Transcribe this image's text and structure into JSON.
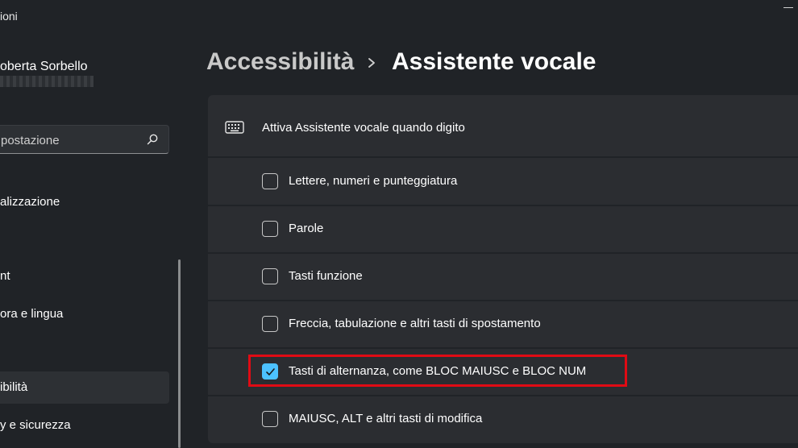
{
  "app": {
    "title": "ioni"
  },
  "user": {
    "name": "oberta Sorbello"
  },
  "search": {
    "text": "postazione"
  },
  "nav": {
    "items": [
      {
        "label": "alizzazione"
      },
      {
        "label": "nt"
      },
      {
        "label": "ora e lingua"
      },
      {
        "label": "ibilità"
      },
      {
        "label": "y e sicurezza"
      }
    ]
  },
  "breadcrumb": {
    "parent": "Accessibilità",
    "current": "Assistente vocale"
  },
  "section": {
    "header_label": "Attiva Assistente vocale quando digito",
    "options": [
      {
        "label": "Lettere, numeri e punteggiatura",
        "checked": false
      },
      {
        "label": "Parole",
        "checked": false
      },
      {
        "label": "Tasti funzione",
        "checked": false
      },
      {
        "label": "Freccia, tabulazione e altri tasti di spostamento",
        "checked": false
      },
      {
        "label": "Tasti di alternanza, come BLOC MAIUSC e BLOC NUM",
        "checked": true
      },
      {
        "label": "MAIUSC, ALT e altri tasti di modifica",
        "checked": false
      }
    ]
  },
  "colors": {
    "accent": "#4cc2ff",
    "highlight": "#e00b14",
    "background": "#202327",
    "card": "#2b2d31"
  }
}
